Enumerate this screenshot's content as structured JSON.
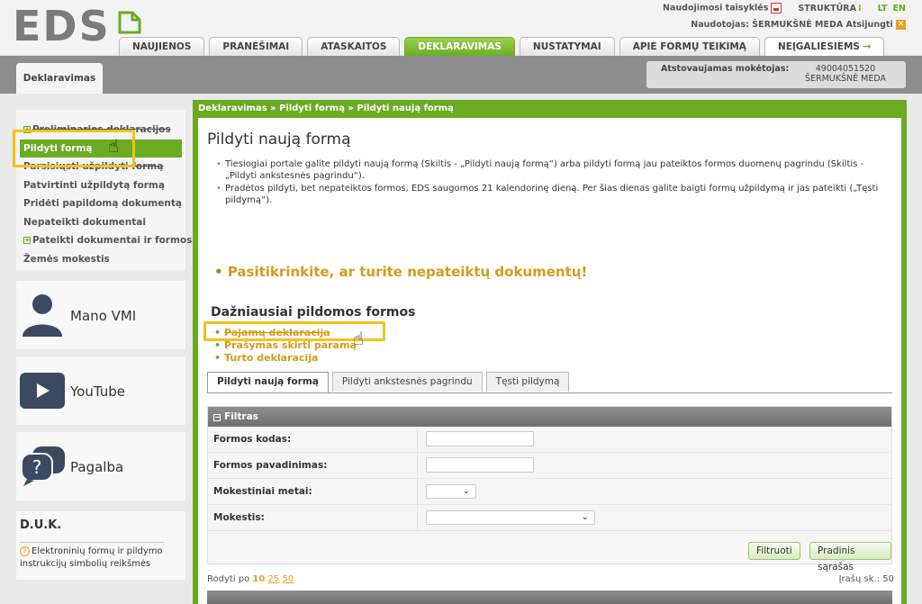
{
  "header": {
    "logo": "EDS",
    "top_links": [
      "Naudojimosi taisyklės",
      "STRUKTŪRA",
      "LT",
      "EN"
    ],
    "user_label": "Naudotojas:",
    "user_name": "ŠERMUKŠNĖ MEDA",
    "logout": "Atsijungti",
    "tabs": [
      "NAUJIENOS",
      "PRANEŠIMAI",
      "ATASKAITOS",
      "DEKLARAVIMAS",
      "NUSTATYMAI",
      "APIE FORMŲ TEIKIMĄ",
      "NEĮGALIESIEMS"
    ],
    "active_tab": "DEKLARAVIMAS",
    "access_arrow": "→"
  },
  "subbar": {
    "section_tab": "Deklaravimas",
    "payer_label": "Atstovaujamas mokėtojas:",
    "payer_code": "49004051520",
    "payer_name": "ŠERMUKŠNĖ MEDA"
  },
  "sidebar": {
    "items": [
      {
        "label": "Preliminarios deklaracijos",
        "plus": true
      },
      {
        "label": "Pildyti formą",
        "active": true
      },
      {
        "label": "Parsisiųsti užpildyti formą"
      },
      {
        "label": "Patvirtinti užpildytą formą"
      },
      {
        "label": "Pridėti papildomą dokumentą"
      },
      {
        "label": "Nepateikti dokumentai"
      },
      {
        "label": "Pateikti dokumentai ir formos",
        "plus": true
      },
      {
        "label": "Žemės mokestis"
      }
    ],
    "panels": {
      "mano_vmi": "Mano VMI",
      "youtube": "YouTube",
      "pagalba": "Pagalba"
    },
    "duk": {
      "title": "D.U.K.",
      "link": "Elektroninių formų ir pildymo instrukcijų simbolių reikšmės"
    }
  },
  "main": {
    "breadcrumb": "Deklaravimas » Pildyti formą » Pildyti naują formą",
    "title": "Pildyti naują formą",
    "intro": [
      "Tiesiogiai portale galite pildyti naują formą (Skiltis - „Pildyti naują formą“) arba pildyti formą jau pateiktos formos duomenų pagrindu (Skiltis - „Pildyti ankstesnės pagrindu“).",
      "Pradėtos pildyti, bet nepateiktos formos, EDS saugomos 21 kalendorinę dieną. Per šias dienas galite baigti formų užpildymą ir jas pateikti („Tęsti pildymą“)."
    ],
    "warning": "Pasitikrinkite, ar turite nepateiktų dokumentų!",
    "frequent_title": "Dažniausiai pildomos formos",
    "frequent": [
      "Pajamų deklaracija",
      "Prašymas skirti paramą",
      "Turto deklaracija"
    ],
    "form_tabs": [
      "Pildyti naują formą",
      "Pildyti ankstesnės pagrindu",
      "Tęsti pildymą"
    ],
    "filter": {
      "title": "Filtras",
      "fields": [
        "Formos kodas:",
        "Formos pavadinimas:",
        "Mokestiniai metai:",
        "Mokestis:"
      ],
      "buttons": [
        "Filtruoti",
        "Pradinis sąrašas"
      ]
    },
    "paging": {
      "label": "Rodyti po",
      "options": [
        "10",
        "25",
        "50"
      ],
      "current": "10",
      "count_label": "Įrašų sk.:",
      "count": "50"
    }
  },
  "colors": {
    "accent": "#6aab22",
    "highlight": "#f2c21a",
    "warning": "#d59b1a"
  }
}
